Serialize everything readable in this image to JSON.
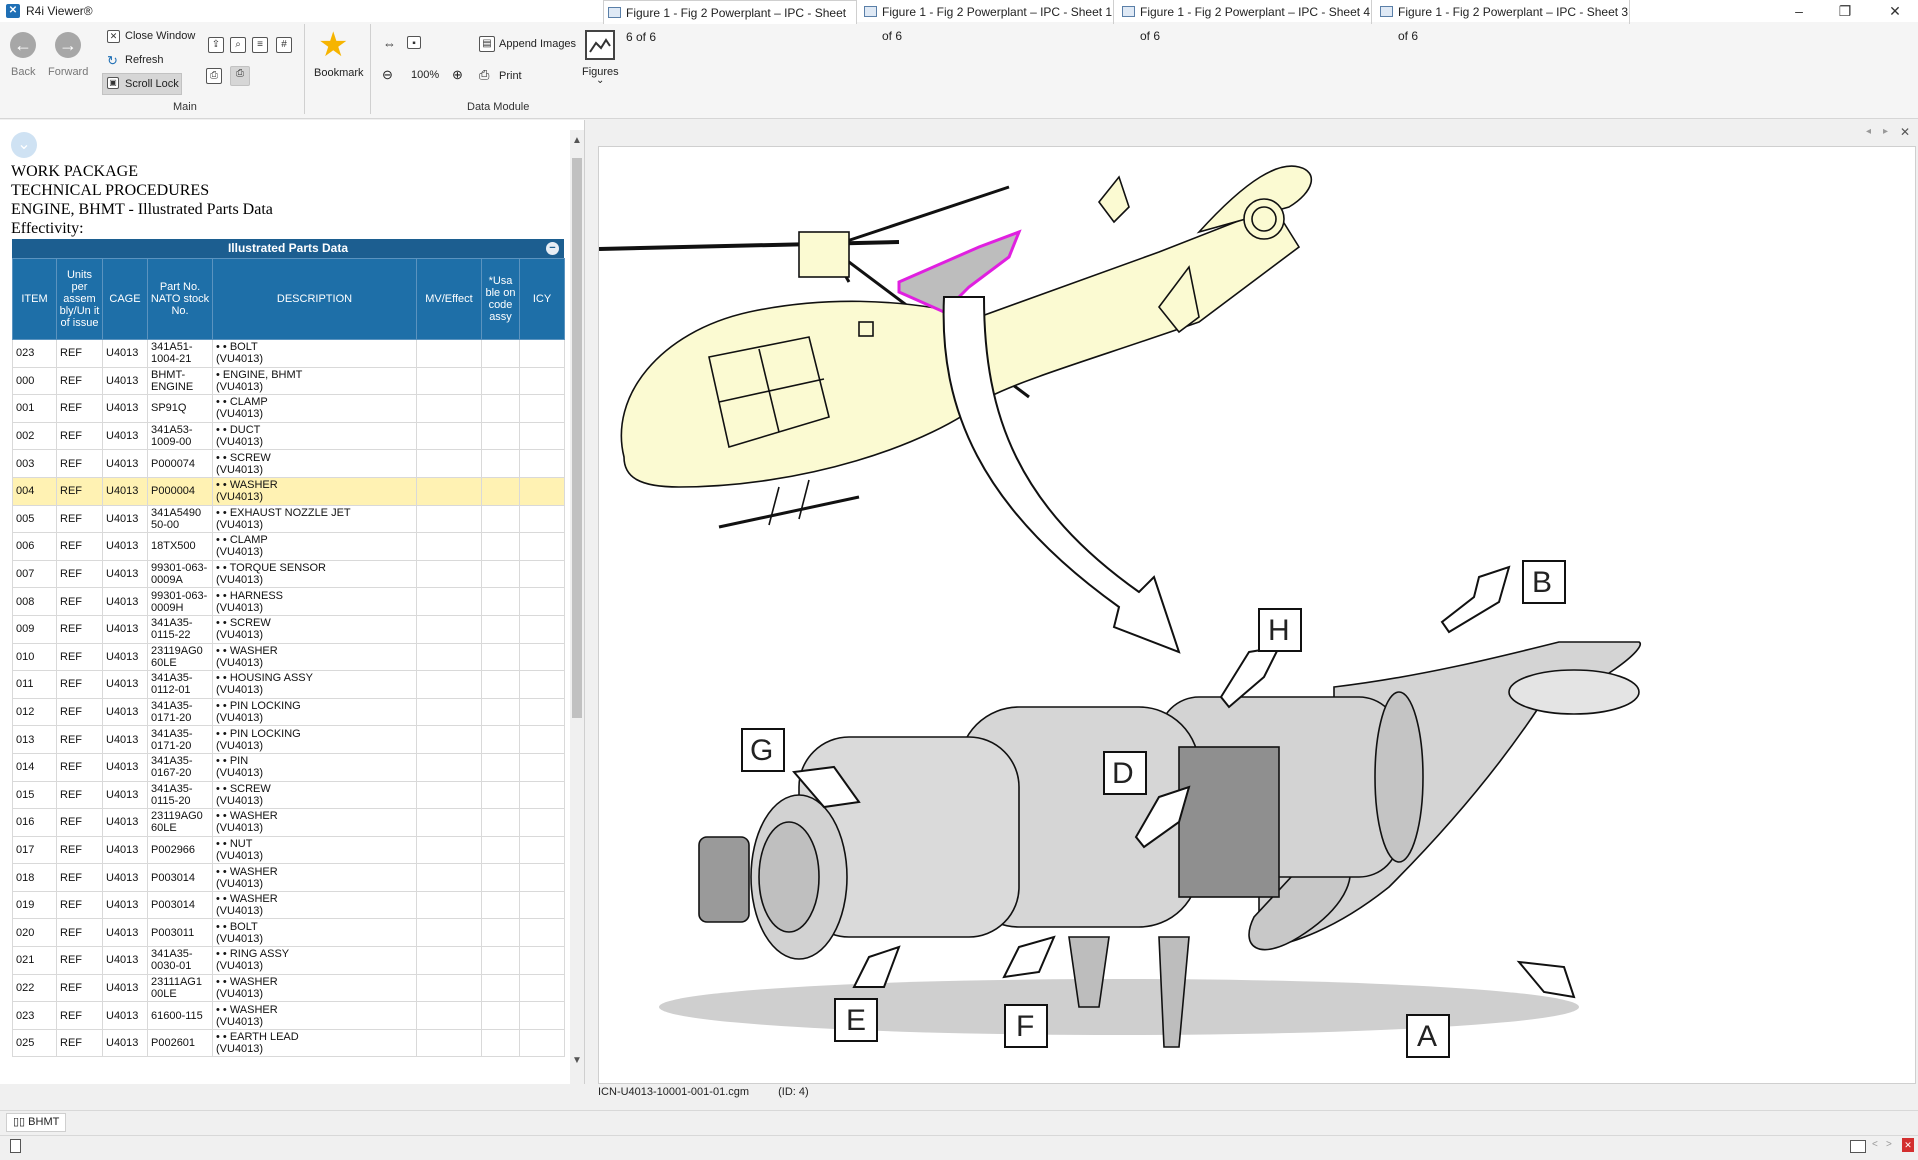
{
  "window": {
    "title": "R4i Viewer®"
  },
  "ribbon": {
    "back_label": "Back",
    "forward_label": "Forward",
    "close_window_label": "Close Window",
    "refresh_label": "Refresh",
    "scroll_lock_label": "Scroll Lock",
    "bookmark_label": "Bookmark",
    "main_group_label": "Main",
    "zoom_level": "100%",
    "append_images_label": "Append Images",
    "print_label": "Print",
    "figures_label": "Figures",
    "figures_chevron": "⌄",
    "data_module_group_label": "Data Module"
  },
  "document": {
    "line1": "WORK PACKAGE",
    "line2": "TECHNICAL PROCEDURES",
    "line3": "ENGINE, BHMT - Illustrated Parts Data",
    "line4": "Effectivity:"
  },
  "ipd": {
    "title": "Illustrated Parts Data",
    "columns": [
      "ITEM",
      "Units per assem bly/Un it of issue",
      "CAGE",
      "Part No. NATO stock No.",
      "DESCRIPTION",
      "MV/Effect",
      "*Usa ble on code assy",
      "ICY"
    ],
    "rows": [
      {
        "item": "023",
        "units": "REF",
        "cage": "U4013",
        "part": "341A51-1004-21",
        "desc": "• • BOLT",
        "eff": "(VU4013)"
      },
      {
        "item": "000",
        "units": "REF",
        "cage": "U4013",
        "part": "BHMT-ENGINE",
        "desc": "• ENGINE, BHMT",
        "eff": "(VU4013)"
      },
      {
        "item": "001",
        "units": "REF",
        "cage": "U4013",
        "part": "SP91Q",
        "desc": "• • CLAMP",
        "eff": "(VU4013)"
      },
      {
        "item": "002",
        "units": "REF",
        "cage": "U4013",
        "part": "341A53-1009-00",
        "desc": "• • DUCT",
        "eff": "(VU4013)"
      },
      {
        "item": "003",
        "units": "REF",
        "cage": "U4013",
        "part": "P000074",
        "desc": "• • SCREW",
        "eff": "(VU4013)"
      },
      {
        "item": "004",
        "units": "REF",
        "cage": "U4013",
        "part": "P000004",
        "desc": "• • WASHER",
        "eff": "(VU4013)"
      },
      {
        "item": "005",
        "units": "REF",
        "cage": "U4013",
        "part": "341A5490 50-00",
        "desc": "• • EXHAUST NOZZLE JET",
        "eff": "(VU4013)"
      },
      {
        "item": "006",
        "units": "REF",
        "cage": "U4013",
        "part": "18TX500",
        "desc": "• • CLAMP",
        "eff": "(VU4013)"
      },
      {
        "item": "007",
        "units": "REF",
        "cage": "U4013",
        "part": "99301-063-0009A",
        "desc": "• • TORQUE SENSOR",
        "eff": "(VU4013)"
      },
      {
        "item": "008",
        "units": "REF",
        "cage": "U4013",
        "part": "99301-063-0009H",
        "desc": "• • HARNESS",
        "eff": "(VU4013)"
      },
      {
        "item": "009",
        "units": "REF",
        "cage": "U4013",
        "part": "341A35-0115-22",
        "desc": "• • SCREW",
        "eff": "(VU4013)"
      },
      {
        "item": "010",
        "units": "REF",
        "cage": "U4013",
        "part": "23119AG0 60LE",
        "desc": "• • WASHER",
        "eff": "(VU4013)"
      },
      {
        "item": "011",
        "units": "REF",
        "cage": "U4013",
        "part": "341A35-0112-01",
        "desc": "• • HOUSING ASSY",
        "eff": "(VU4013)"
      },
      {
        "item": "012",
        "units": "REF",
        "cage": "U4013",
        "part": "341A35-0171-20",
        "desc": "• • PIN LOCKING",
        "eff": "(VU4013)"
      },
      {
        "item": "013",
        "units": "REF",
        "cage": "U4013",
        "part": "341A35-0171-20",
        "desc": "• • PIN LOCKING",
        "eff": "(VU4013)"
      },
      {
        "item": "014",
        "units": "REF",
        "cage": "U4013",
        "part": "341A35-0167-20",
        "desc": "• • PIN",
        "eff": "(VU4013)"
      },
      {
        "item": "015",
        "units": "REF",
        "cage": "U4013",
        "part": "341A35-0115-20",
        "desc": "• • SCREW",
        "eff": "(VU4013)"
      },
      {
        "item": "016",
        "units": "REF",
        "cage": "U4013",
        "part": "23119AG0 60LE",
        "desc": "• • WASHER",
        "eff": "(VU4013)"
      },
      {
        "item": "017",
        "units": "REF",
        "cage": "U4013",
        "part": "P002966",
        "desc": "• • NUT",
        "eff": "(VU4013)"
      },
      {
        "item": "018",
        "units": "REF",
        "cage": "U4013",
        "part": "P003014",
        "desc": "• • WASHER",
        "eff": "(VU4013)"
      },
      {
        "item": "019",
        "units": "REF",
        "cage": "U4013",
        "part": "P003014",
        "desc": "• • WASHER",
        "eff": "(VU4013)"
      },
      {
        "item": "020",
        "units": "REF",
        "cage": "U4013",
        "part": "P003011",
        "desc": "• • BOLT",
        "eff": "(VU4013)"
      },
      {
        "item": "021",
        "units": "REF",
        "cage": "U4013",
        "part": "341A35-0030-01",
        "desc": "• • RING ASSY",
        "eff": "(VU4013)"
      },
      {
        "item": "022",
        "units": "REF",
        "cage": "U4013",
        "part": "23111AG1 00LE",
        "desc": "• • WASHER",
        "eff": "(VU4013)"
      },
      {
        "item": "023",
        "units": "REF",
        "cage": "U4013",
        "part": "61600-115",
        "desc": "• • WASHER",
        "eff": "(VU4013)"
      },
      {
        "item": "025",
        "units": "REF",
        "cage": "U4013",
        "part": "P002601",
        "desc": "• • EARTH LEAD",
        "eff": "(VU4013)"
      }
    ]
  },
  "tabs": [
    {
      "label": "Figure 1 - Fig 2 Powerplant – IPC - Sheet 6 of 6"
    },
    {
      "label": "Figure 1 - Fig 2 Powerplant – IPC - Sheet 1 of 6"
    },
    {
      "label": "Figure 1 - Fig 2 Powerplant – IPC - Sheet 4 of 6"
    },
    {
      "label": "Figure 1 - Fig 2 Powerplant – IPC - Sheet 3 of 6"
    }
  ],
  "figure": {
    "callouts": {
      "a": "A",
      "b": "B",
      "d": "D",
      "e": "E",
      "f": "F",
      "g": "G",
      "h": "H"
    }
  },
  "status": {
    "filename": "ICN-U4013-10001-001-01.cgm",
    "id": "(ID: 4)",
    "bottom_tab": "BHMT"
  },
  "colors": {
    "accent": "#1e6fa8",
    "selection": "#fff2b3",
    "helicopter": "#fbfad2",
    "engine": "#d9d9d9",
    "highlight": "#e020e0"
  }
}
